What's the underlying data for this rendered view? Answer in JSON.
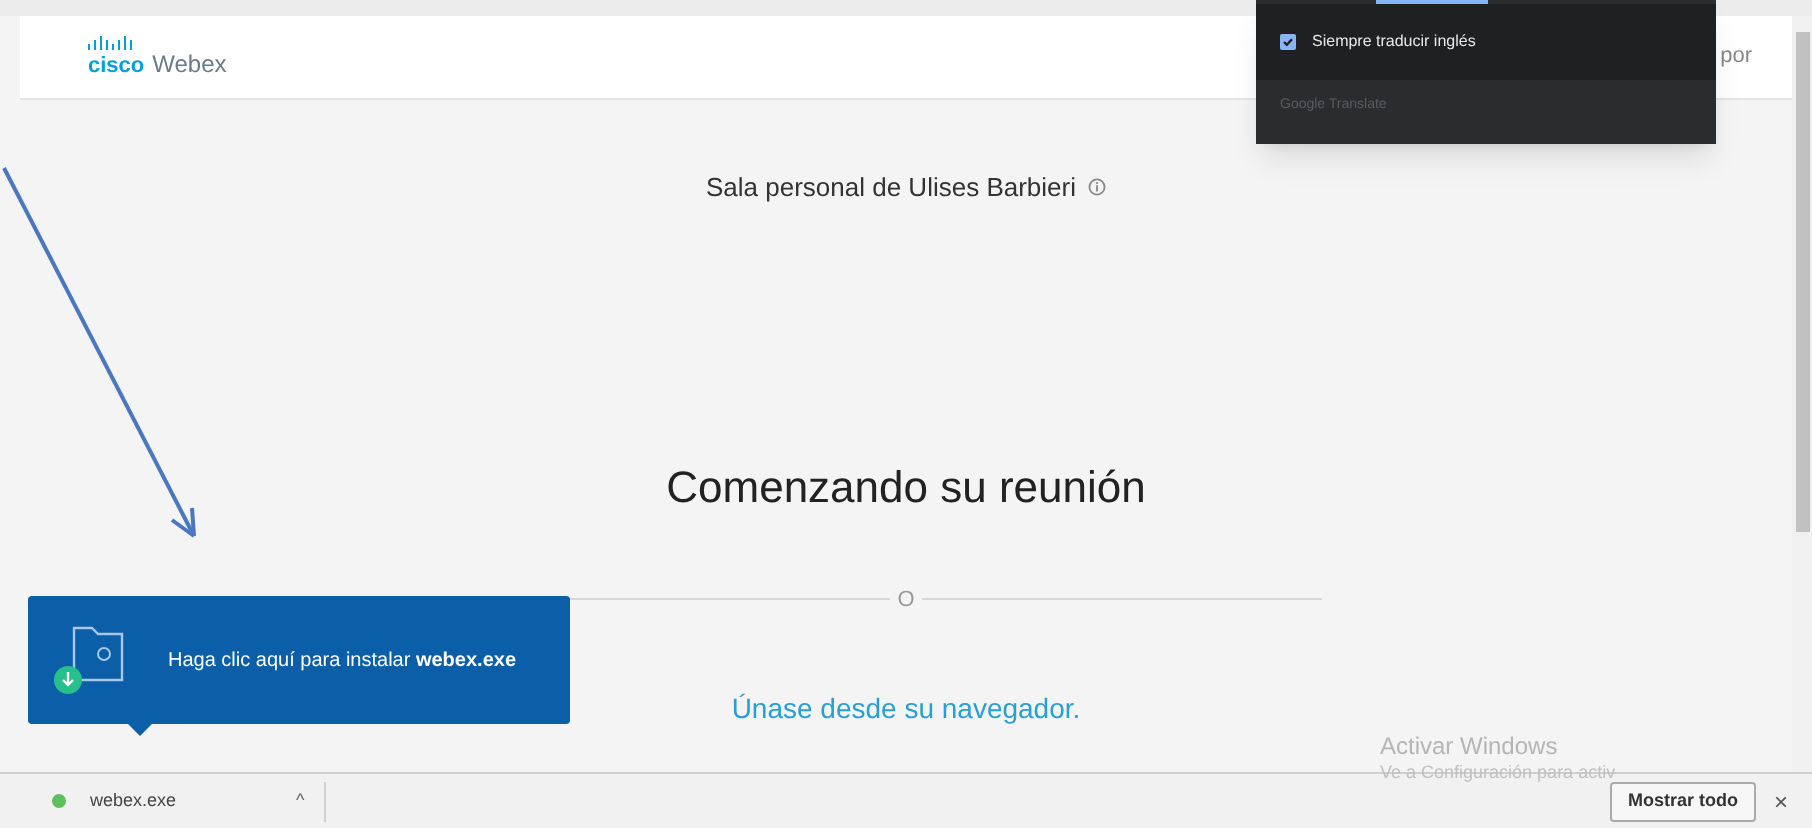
{
  "header": {
    "logo_mark": "cisco",
    "logo_text": "Webex",
    "trailing_text": "por"
  },
  "translate_popup": {
    "option": {
      "label": "Siempre traducir inglés",
      "checked": true
    },
    "footer": "Google Translate"
  },
  "meeting": {
    "room_title": "Sala personal de Ulises Barbieri",
    "status": "Comenzando su reunión",
    "divider_label": "O",
    "join_link": "Únase desde su navegador."
  },
  "install_tip": {
    "text": "Haga clic aquí para instalar **webex.exe**"
  },
  "os_notice": {
    "title": "Activar Windows",
    "subtitle": "Ve a Configuración para activ"
  },
  "download_bar": {
    "file": {
      "name": "webex.exe",
      "color": "#5cc15a"
    },
    "caret": "^",
    "show_all": "Mostrar todo",
    "close": "×"
  }
}
